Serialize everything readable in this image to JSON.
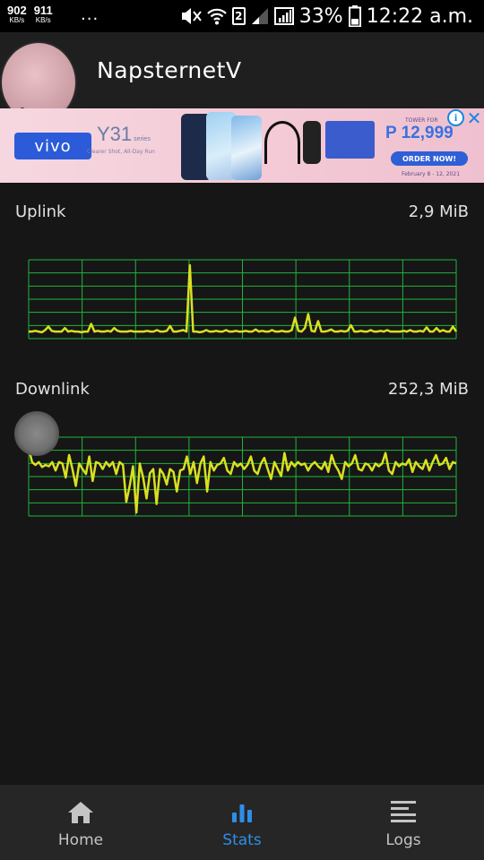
{
  "status_bar": {
    "speed_up": "902",
    "speed_up_unit": "KB/s",
    "speed_down": "911",
    "speed_down_unit": "KB/s",
    "overflow": "...",
    "sim_slot": "2",
    "battery": "33%",
    "time": "12:22 a.m."
  },
  "header": {
    "title": "NapsternetV"
  },
  "ad": {
    "brand": "vivo",
    "model": "Y31",
    "model_suffix": "series",
    "copy": "Clearer Shot, All-Day Run",
    "sale_label": "TOWER FOR",
    "price": "P 12,999",
    "cta": "ORDER NOW!",
    "dates": "February 8 - 12, 2021",
    "info_icon": "i",
    "close_icon": "✕"
  },
  "stats": {
    "uplink": {
      "label": "Uplink",
      "value": "2,9 MiB"
    },
    "downlink": {
      "label": "Downlink",
      "value": "252,3 MiB"
    }
  },
  "graph_style": {
    "grid_color": "#1fb53a",
    "line_color": "#d9e021",
    "background": "#161616"
  },
  "graphs": {
    "uplink": [
      0.05,
      0.05,
      0.06,
      0.05,
      0.04,
      0.07,
      0.12,
      0.06,
      0.05,
      0.05,
      0.05,
      0.1,
      0.05,
      0.06,
      0.05,
      0.05,
      0.04,
      0.05,
      0.05,
      0.16,
      0.05,
      0.06,
      0.05,
      0.05,
      0.06,
      0.05,
      0.1,
      0.06,
      0.05,
      0.05,
      0.05,
      0.06,
      0.05,
      0.05,
      0.05,
      0.05,
      0.06,
      0.05,
      0.05,
      0.07,
      0.05,
      0.05,
      0.06,
      0.13,
      0.05,
      0.05,
      0.06,
      0.07,
      0.05,
      1.0,
      0.05,
      0.05,
      0.04,
      0.05,
      0.07,
      0.05,
      0.05,
      0.06,
      0.05,
      0.05,
      0.07,
      0.05,
      0.05,
      0.06,
      0.05,
      0.05,
      0.06,
      0.05,
      0.05,
      0.08,
      0.05,
      0.06,
      0.05,
      0.05,
      0.07,
      0.05,
      0.05,
      0.06,
      0.05,
      0.05,
      0.07,
      0.25,
      0.06,
      0.05,
      0.1,
      0.3,
      0.06,
      0.05,
      0.2,
      0.05,
      0.05,
      0.06,
      0.08,
      0.05,
      0.05,
      0.06,
      0.05,
      0.06,
      0.14,
      0.05,
      0.05,
      0.06,
      0.05,
      0.05,
      0.07,
      0.05,
      0.05,
      0.06,
      0.05,
      0.07,
      0.05,
      0.05,
      0.05,
      0.05,
      0.06,
      0.05,
      0.07,
      0.05,
      0.05,
      0.06,
      0.05,
      0.11,
      0.05,
      0.05,
      0.1,
      0.05,
      0.07,
      0.05,
      0.05,
      0.12,
      0.05
    ],
    "downlink": [
      0.92,
      0.72,
      0.68,
      0.72,
      0.65,
      0.68,
      0.66,
      0.72,
      0.6,
      0.72,
      0.7,
      0.5,
      0.82,
      0.62,
      0.38,
      0.7,
      0.62,
      0.55,
      0.8,
      0.45,
      0.72,
      0.7,
      0.62,
      0.72,
      0.66,
      0.72,
      0.55,
      0.72,
      0.68,
      0.15,
      0.38,
      0.66,
      0.0,
      0.7,
      0.5,
      0.2,
      0.56,
      0.62,
      0.12,
      0.62,
      0.55,
      0.4,
      0.62,
      0.58,
      0.3,
      0.6,
      0.62,
      0.8,
      0.55,
      0.72,
      0.42,
      0.7,
      0.8,
      0.3,
      0.72,
      0.6,
      0.68,
      0.7,
      0.78,
      0.6,
      0.55,
      0.72,
      0.66,
      0.7,
      0.62,
      0.68,
      0.8,
      0.6,
      0.55,
      0.7,
      0.78,
      0.62,
      0.48,
      0.72,
      0.62,
      0.52,
      0.85,
      0.6,
      0.72,
      0.66,
      0.72,
      0.68,
      0.7,
      0.6,
      0.68,
      0.72,
      0.66,
      0.62,
      0.72,
      0.58,
      0.82,
      0.68,
      0.6,
      0.48,
      0.72,
      0.66,
      0.7,
      0.82,
      0.62,
      0.6,
      0.7,
      0.68,
      0.6,
      0.7,
      0.66,
      0.7,
      0.85,
      0.6,
      0.55,
      0.72,
      0.66,
      0.7,
      0.68,
      0.76,
      0.58,
      0.72,
      0.66,
      0.62,
      0.75,
      0.6,
      0.72,
      0.82,
      0.68,
      0.7,
      0.78,
      0.62,
      0.72,
      0.7
    ]
  },
  "nav": {
    "items": [
      {
        "label": "Home",
        "icon": "home-icon",
        "active": false
      },
      {
        "label": "Stats",
        "icon": "bar-chart-icon",
        "active": true
      },
      {
        "label": "Logs",
        "icon": "list-icon",
        "active": false
      }
    ],
    "active_color": "#2f8ee8",
    "inactive_color": "#c4c4c4"
  }
}
